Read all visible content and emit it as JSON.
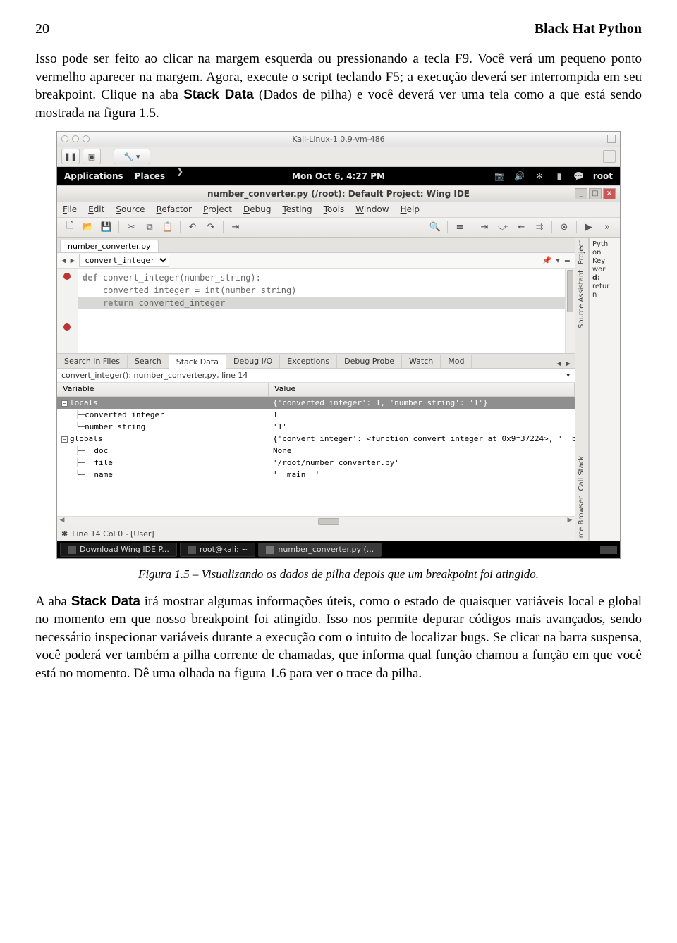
{
  "page": {
    "number": "20",
    "title": "Black Hat Python",
    "para1_a": "Isso pode ser feito ao clicar na margem esquerda ou pressionando a tecla ",
    "para1_f9": "F9",
    "para1_b": ". Você verá um pequeno ponto vermelho aparecer na margem. Agora, execute o script teclando F5; a execução deverá ser interrompida em seu breakpoint. Clique na aba ",
    "para1_sd": "Stack Data",
    "para1_c": " (Dados de pilha) e você deverá ver uma tela como a que está sendo mostrada na figura 1.5.",
    "caption": "Figura 1.5 – Visualizando os dados de pilha depois que um breakpoint foi atingido.",
    "para2_a": "A aba ",
    "para2_sd": "Stack Data",
    "para2_b": " irá mostrar algumas informações úteis, como o estado de quaisquer variáveis local e global no momento em que nosso breakpoint foi atingido. Isso nos permite depurar códigos mais avançados, sendo necessário inspecionar variáveis durante a execução com o intuito de localizar bugs. Se clicar na barra suspensa, você poderá ver também a pilha corrente de chamadas, que informa qual função chamou a função em que você está no momento. Dê uma olhada na figura 1.6 para ver o trace da pilha."
  },
  "mac": {
    "title": "Kali-Linux-1.0.9-vm-486"
  },
  "kali_top": {
    "apps": "Applications",
    "places": "Places",
    "clock": "Mon Oct  6, 4:27 PM",
    "user": "root"
  },
  "win": {
    "title": "number_converter.py (/root): Default Project: Wing IDE"
  },
  "menu": {
    "file": "File",
    "edit": "Edit",
    "source": "Source",
    "refactor": "Refactor",
    "project": "Project",
    "debug": "Debug",
    "testing": "Testing",
    "tools": "Tools",
    "window": "Window",
    "help": "Help"
  },
  "editor": {
    "tab": "number_converter.py",
    "combo": "convert_integer",
    "lines": {
      "l1": "def convert_integer(number_string):",
      "l2": "",
      "l3": "    converted_integer = int(number_string)",
      "l4": "",
      "l5": "    return converted_integer"
    }
  },
  "side": {
    "project": "Project",
    "assistant": "Source Assistant",
    "callstack": "Call Stack",
    "browser": "rce Browser",
    "panel": "Python Keyword: return"
  },
  "bottom": {
    "tabs": {
      "sif": "Search in Files",
      "search": "Search",
      "stack": "Stack Data",
      "dio": "Debug I/O",
      "exc": "Exceptions",
      "dp": "Debug Probe",
      "watch": "Watch",
      "mod": "Mod"
    },
    "stackline": "convert_integer(): number_converter.py, line 14",
    "cols": {
      "var": "Variable",
      "val": "Value"
    },
    "rows": {
      "locals": {
        "v": "locals",
        "val": "{'converted_integer': 1, 'number_string': '1'}"
      },
      "ci": {
        "v": "converted_integer",
        "val": "1"
      },
      "ns": {
        "v": "number_string",
        "val": "'1'"
      },
      "globals": {
        "v": "globals",
        "val": "{'convert_integer': <function convert_integer at 0x9f37224>, '__b ..."
      },
      "doc": {
        "v": "__doc__",
        "val": "None"
      },
      "file": {
        "v": "__file__",
        "val": "'/root/number_converter.py'"
      },
      "name": {
        "v": "__name__",
        "val": "'__main__'"
      }
    }
  },
  "status": {
    "line": "Line 14 Col 0 - [User]"
  },
  "taskbar": {
    "t1": "Download Wing IDE P...",
    "t2": "root@kali: ~",
    "t3": "number_converter.py (..."
  }
}
